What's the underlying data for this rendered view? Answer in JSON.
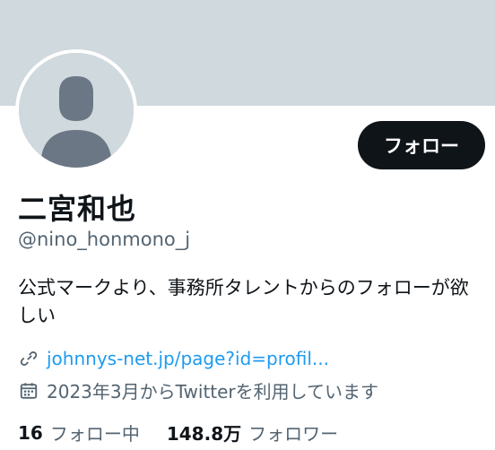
{
  "profile": {
    "display_name": "二宮和也",
    "handle": "@nino_honmono_j",
    "bio": "公式マークより、事務所タレントからのフォローが欲しい",
    "link": "johnnys-net.jp/page?id=profil...",
    "joined": "2023年3月からTwitterを利用しています",
    "avatar_icon": "default-avatar-icon",
    "link_icon": "link-icon",
    "calendar_icon": "calendar-icon"
  },
  "actions": {
    "follow_label": "フォロー"
  },
  "stats": {
    "following_count": "16",
    "following_label": "フォロー中",
    "followers_count": "148.8万",
    "followers_label": "フォロワー"
  },
  "colors": {
    "banner": "#cfd9de",
    "accent_link": "#1d9bf0",
    "button_bg": "#0f1419",
    "secondary_text": "#536471"
  }
}
